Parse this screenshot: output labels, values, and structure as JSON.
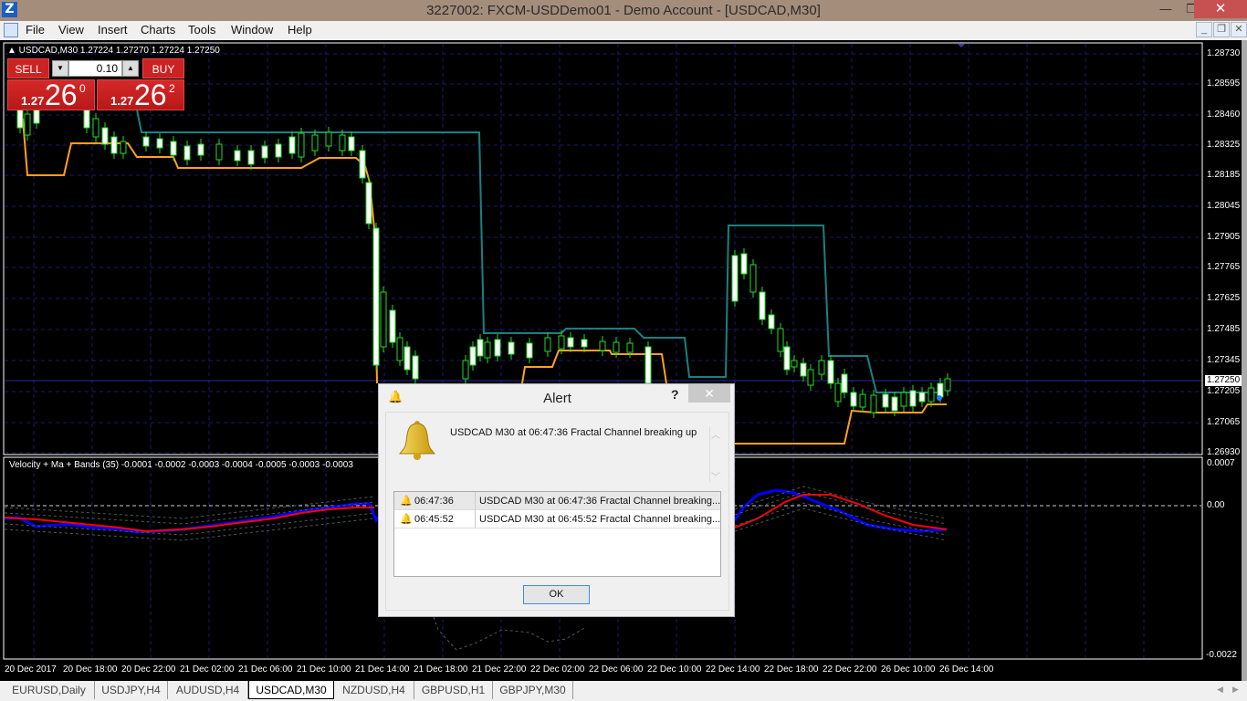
{
  "window": {
    "title": "3227002: FXCM-USDDemo01 - Demo Account - [USDCAD,M30]",
    "app_icon": "Z",
    "minimize": "—",
    "maximize": "❐",
    "close": "✕"
  },
  "menu": {
    "items": [
      "File",
      "View",
      "Insert",
      "Charts",
      "Tools",
      "Window",
      "Help"
    ]
  },
  "mdi": {
    "minimize": "_",
    "restore": "❐",
    "close": "✕"
  },
  "chart": {
    "header": "▲ USDCAD,M30  1.27224 1.27270 1.27224 1.27250",
    "price_labels": [
      "1.28730",
      "1.28595",
      "1.28460",
      "1.28325",
      "1.28185",
      "1.28045",
      "1.27905",
      "1.27765",
      "1.27625",
      "1.27485",
      "1.27345",
      "1.27205",
      "1.27065",
      "1.26930"
    ],
    "current_price": "1.27250",
    "indicator_title": "Velocity + Ma + Bands (35) -0.0001 -0.0002 -0.0003 -0.0004 -0.0005 -0.0003 -0.0003",
    "indicator_labels": [
      "0.0007",
      "0.00",
      "-0.0022"
    ],
    "time_labels": [
      "20 Dec 2017",
      "20 Dec 18:00",
      "20 Dec 22:00",
      "21 Dec 02:00",
      "21 Dec 06:00",
      "21 Dec 10:00",
      "21 Dec 14:00",
      "21 Dec 18:00",
      "21 Dec 22:00",
      "22 Dec 02:00",
      "22 Dec 06:00",
      "22 Dec 10:00",
      "22 Dec 14:00",
      "22 Dec 18:00",
      "22 Dec 22:00",
      "26 Dec 10:00",
      "26 Dec 14:00"
    ],
    "colors": {
      "upper_channel": "#1b8080",
      "lower_channel": "#ffa020",
      "candle": "#22dd22",
      "velocity": "#0000ff",
      "ma": "#ff0000",
      "grid": "#1a1a6e"
    }
  },
  "trade_panel": {
    "sell_label": "SELL",
    "buy_label": "BUY",
    "lot": "0.10",
    "lot_down": "▼",
    "lot_up": "▲",
    "sell_price": {
      "prefix": "1.27",
      "big": "26",
      "sup": "0"
    },
    "buy_price": {
      "prefix": "1.27",
      "big": "26",
      "sup": "2"
    }
  },
  "alert": {
    "title": "Alert",
    "help": "?",
    "close": "✕",
    "message": "USDCAD M30 at 06:47:36 Fractal Channel breaking up",
    "scroll_up": "︿",
    "scroll_down": "﹀",
    "history": [
      {
        "time": "06:47:36",
        "message": "USDCAD M30 at 06:47:36 Fractal Channel breaking..."
      },
      {
        "time": "06:45:52",
        "message": "USDCAD M30 at 06:45:52 Fractal Channel breaking..."
      }
    ],
    "ok_label": "OK"
  },
  "tabs": [
    {
      "label": "EURUSD,Daily",
      "active": false
    },
    {
      "label": "USDJPY,H4",
      "active": false
    },
    {
      "label": "AUDUSD,H4",
      "active": false
    },
    {
      "label": "USDCAD,M30",
      "active": true
    },
    {
      "label": "NZDUSD,H4",
      "active": false
    },
    {
      "label": "GBPUSD,H1",
      "active": false
    },
    {
      "label": "GBPJPY,M30",
      "active": false
    }
  ],
  "tab_scroll": {
    "left": "◀",
    "right": "▶"
  }
}
